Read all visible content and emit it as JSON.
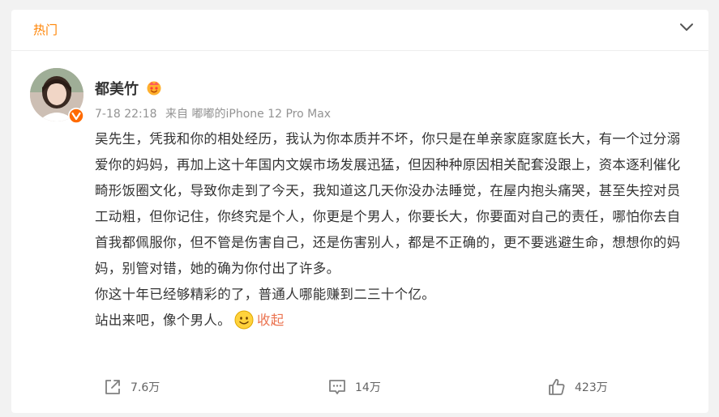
{
  "header": {
    "tab_label": "热门"
  },
  "post": {
    "username": "都美竹",
    "time": "7-18 22:18",
    "source_prefix": "来自",
    "source": "嘟嘟的iPhone 12 Pro Max",
    "paragraphs": [
      "吴先生，凭我和你的相处经历，我认为你本质并不坏，你只是在单亲家庭家庭长大，有一个过分溺爱你的妈妈，再加上这十年国内文娱市场发展迅猛，但因种种原因相关配套没跟上，资本逐利催化畸形饭圈文化，导致你走到了今天，我知道这几天你没办法睡觉，在屋内抱头痛哭，甚至失控对员工动粗，但你记住，你终究是个人，你更是个男人，你要长大，你要面对自己的责任，哪怕你去自首我都佩服你，但不管是伤害自己，还是伤害别人，都是不正确的，更不要逃避生命，想想你的妈妈，别管对错，她的确为你付出了许多。",
      "你这十年已经够精彩的了，普通人哪能赚到二三十个亿。",
      "站出来吧，像个男人。"
    ],
    "collapse_label": "收起"
  },
  "actions": {
    "share_count": "7.6万",
    "comment_count": "14万",
    "like_count": "423万"
  },
  "colors": {
    "accent": "#ff8200",
    "link": "#eb7350",
    "verified": "#ff6a00"
  },
  "icons": {
    "expand": "chevron-down-icon",
    "vip": "vip-badge-icon",
    "verified": "verified-badge-icon",
    "emoji": "smile-emoji-icon",
    "share": "share-icon",
    "comment": "comment-icon",
    "like": "thumbs-up-icon"
  }
}
